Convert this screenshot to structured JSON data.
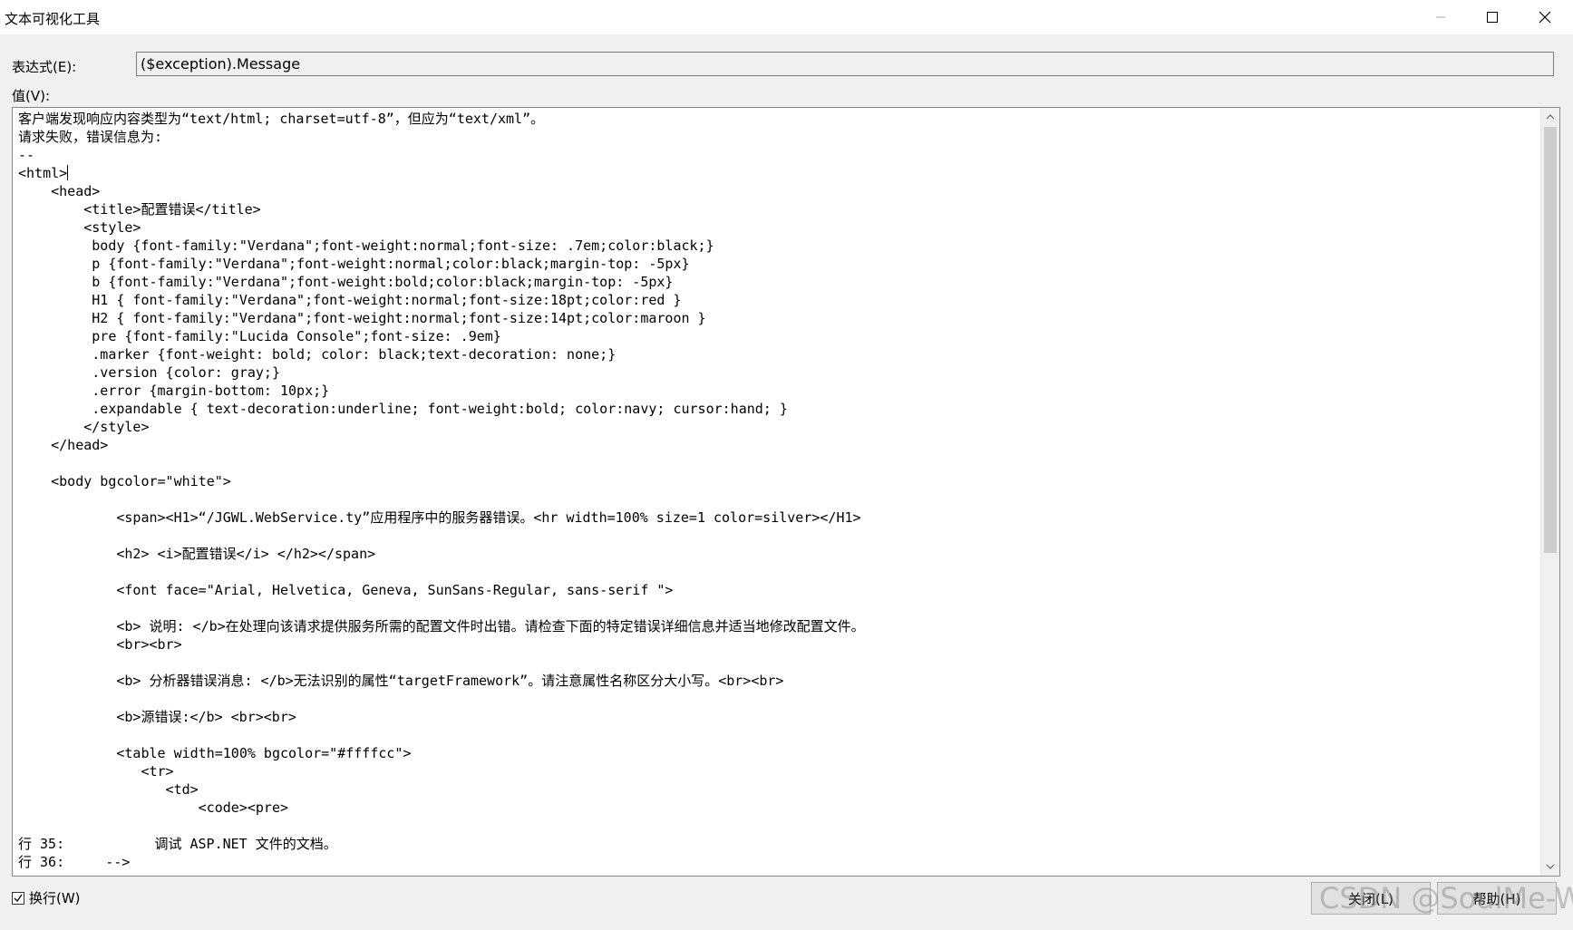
{
  "window": {
    "title": "文本可视化工具"
  },
  "expression": {
    "label": "表达式(E):",
    "value": "($exception).Message"
  },
  "value_label": "值(V):",
  "text_lines": [
    "客户端发现响应内容类型为“text/html; charset=utf-8”，但应为“text/xml”。",
    "请求失败，错误信息为:",
    "--",
    "<html>",
    "    <head>",
    "        <title>配置错误</title>",
    "        <style>",
    "         body {font-family:\"Verdana\";font-weight:normal;font-size: .7em;color:black;}",
    "         p {font-family:\"Verdana\";font-weight:normal;color:black;margin-top: -5px}",
    "         b {font-family:\"Verdana\";font-weight:bold;color:black;margin-top: -5px}",
    "         H1 { font-family:\"Verdana\";font-weight:normal;font-size:18pt;color:red }",
    "         H2 { font-family:\"Verdana\";font-weight:normal;font-size:14pt;color:maroon }",
    "         pre {font-family:\"Lucida Console\";font-size: .9em}",
    "         .marker {font-weight: bold; color: black;text-decoration: none;}",
    "         .version {color: gray;}",
    "         .error {margin-bottom: 10px;}",
    "         .expandable { text-decoration:underline; font-weight:bold; color:navy; cursor:hand; }",
    "        </style>",
    "    </head>",
    "",
    "    <body bgcolor=\"white\">",
    "",
    "            <span><H1>“/JGWL.WebService.ty”应用程序中的服务器错误。<hr width=100% size=1 color=silver></H1>",
    "",
    "            <h2> <i>配置错误</i> </h2></span>",
    "",
    "            <font face=\"Arial, Helvetica, Geneva, SunSans-Regular, sans-serif \">",
    "",
    "            <b> 说明: </b>在处理向该请求提供服务所需的配置文件时出错。请检查下面的特定错误详细信息并适当地修改配置文件。",
    "            <br><br>",
    "",
    "            <b> 分析器错误消息: </b>无法识别的属性“targetFramework”。请注意属性名称区分大小写。<br><br>",
    "",
    "            <b>源错误:</b> <br><br>",
    "",
    "            <table width=100% bgcolor=\"#ffffcc\">",
    "               <tr>",
    "                  <td>",
    "                      <code><pre>",
    "",
    "行 35:           调试 ASP.NET 文件的文档。",
    "行 36:     -->"
  ],
  "wrap": {
    "label": "换行(W)",
    "checked": true
  },
  "buttons": {
    "close": "关闭(L)",
    "help": "帮助(H)"
  },
  "watermark": "CSDN @SoulMe-W"
}
